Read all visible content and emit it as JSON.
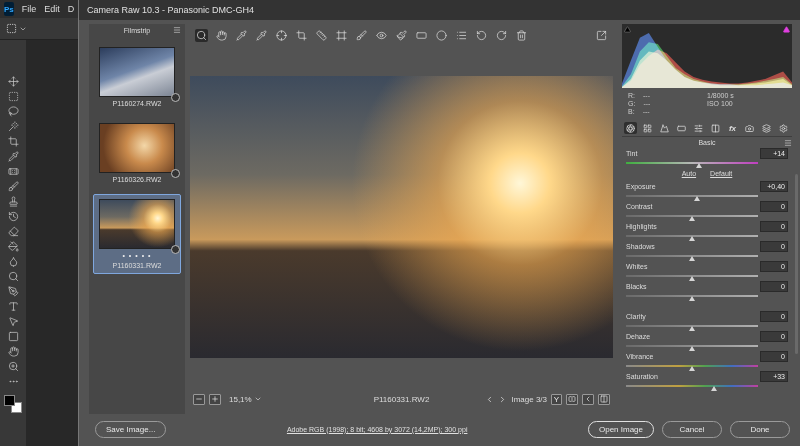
{
  "photoshop": {
    "logo": "Ps",
    "menu": [
      "File",
      "Edit",
      "D"
    ]
  },
  "window": {
    "title": "Camera Raw 10.3  -  Panasonic DMC-GH4"
  },
  "filmstrip": {
    "title": "Filmstrip",
    "items": [
      {
        "name": "P1160274.RW2",
        "selected": false,
        "rating": "",
        "kind": "cool"
      },
      {
        "name": "P1160326.RW2",
        "selected": false,
        "rating": "",
        "kind": "warm"
      },
      {
        "name": "P1160331.RW2",
        "selected": true,
        "rating": "• • • • •",
        "kind": "sunset"
      }
    ]
  },
  "preview": {
    "zoom": "15,1%",
    "filename": "P1160331.RW2",
    "counter": "Image 3/3",
    "compare": "Y"
  },
  "histogram": {
    "series": [
      {
        "color": "#3a6fe0",
        "values": [
          5,
          30,
          55,
          60,
          45,
          30,
          20,
          12,
          8,
          6,
          5,
          4,
          4,
          3,
          3,
          3,
          4,
          5,
          6,
          3
        ]
      },
      {
        "color": "#2fbf4a",
        "values": [
          2,
          15,
          40,
          50,
          48,
          35,
          22,
          15,
          10,
          7,
          5,
          4,
          4,
          4,
          5,
          6,
          8,
          10,
          12,
          4
        ]
      },
      {
        "color": "#e03a2f",
        "values": [
          1,
          8,
          25,
          35,
          42,
          38,
          28,
          18,
          12,
          9,
          7,
          6,
          5,
          5,
          6,
          8,
          10,
          14,
          18,
          6
        ]
      },
      {
        "color": "#d8d860",
        "values": [
          1,
          10,
          30,
          40,
          38,
          30,
          20,
          12,
          8,
          6,
          4,
          3,
          3,
          3,
          4,
          5,
          6,
          8,
          10,
          3
        ]
      }
    ]
  },
  "readout": {
    "channels": [
      {
        "label": "R:",
        "value": "---"
      },
      {
        "label": "G:",
        "value": "---"
      },
      {
        "label": "B:",
        "value": "---"
      }
    ],
    "shutter": "1/8000 s",
    "iso": "ISO 100"
  },
  "panel": {
    "title": "Basic",
    "tabs": [
      {
        "kind": "icon",
        "label": "",
        "selected": true
      },
      {
        "kind": "icon",
        "label": "",
        "selected": false
      },
      {
        "kind": "icon",
        "label": "",
        "selected": false
      },
      {
        "kind": "icon",
        "label": "",
        "selected": false
      },
      {
        "kind": "icon",
        "label": "",
        "selected": false
      },
      {
        "kind": "icon",
        "label": "",
        "selected": false
      },
      {
        "kind": "text",
        "label": "fx",
        "selected": false
      },
      {
        "kind": "icon",
        "label": "",
        "selected": false
      },
      {
        "kind": "icon",
        "label": "",
        "selected": false
      },
      {
        "kind": "icon",
        "label": "",
        "selected": false
      }
    ],
    "auto": "Auto",
    "default": "Default",
    "top": [
      {
        "label": "Tint",
        "value": "+14",
        "level": 0.55,
        "kind": "tint"
      }
    ],
    "tone": [
      {
        "label": "Exposure",
        "value": "+0,40",
        "level": 0.54,
        "kind": "plain"
      },
      {
        "label": "Contrast",
        "value": "0",
        "level": 0.5,
        "kind": "plain"
      },
      {
        "label": "Highlights",
        "value": "0",
        "level": 0.5,
        "kind": "plain"
      },
      {
        "label": "Shadows",
        "value": "0",
        "level": 0.5,
        "kind": "plain"
      },
      {
        "label": "Whites",
        "value": "0",
        "level": 0.5,
        "kind": "plain"
      },
      {
        "label": "Blacks",
        "value": "0",
        "level": 0.5,
        "kind": "plain"
      }
    ],
    "presence": [
      {
        "label": "Clarity",
        "value": "0",
        "level": 0.5,
        "kind": "plain"
      },
      {
        "label": "Dehaze",
        "value": "0",
        "level": 0.5,
        "kind": "plain"
      },
      {
        "label": "Vibrance",
        "value": "0",
        "level": 0.5,
        "kind": "color"
      },
      {
        "label": "Saturation",
        "value": "+33",
        "level": 0.665,
        "kind": "color"
      }
    ]
  },
  "footer": {
    "save": "Save Image...",
    "info": "Adobe RGB (1998); 8 bit; 4608 by 3072 (14,2MP); 300 ppi",
    "open": "Open Image",
    "cancel": "Cancel",
    "done": "Done"
  }
}
